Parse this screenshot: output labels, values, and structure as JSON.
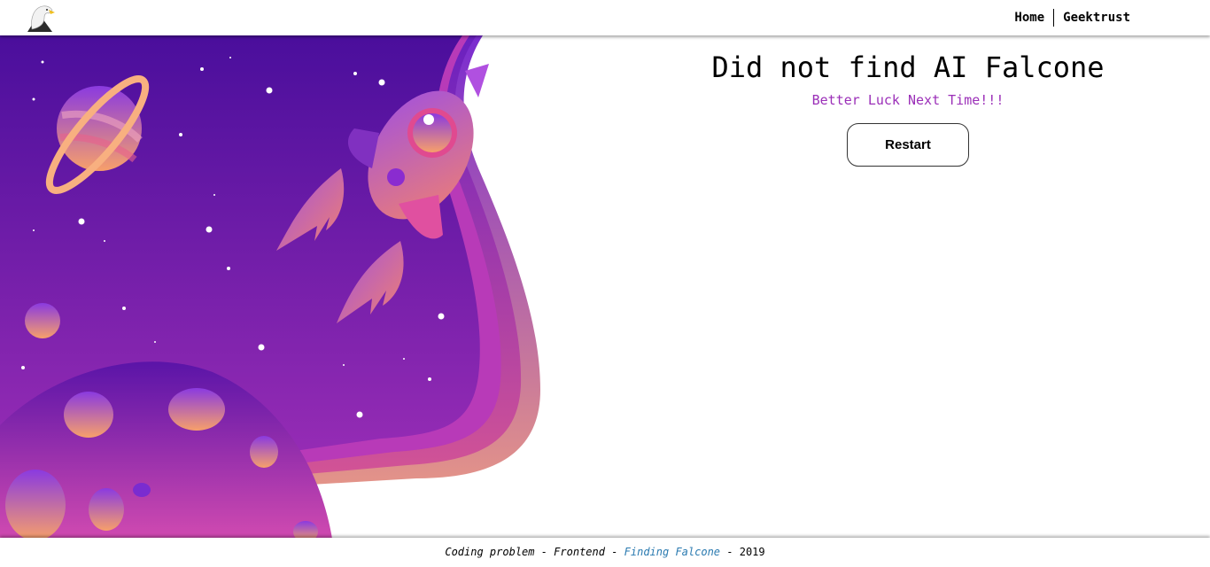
{
  "header": {
    "logo_icon": "eagle-icon",
    "nav": [
      {
        "label": "Home"
      },
      {
        "label": "Geektrust"
      }
    ]
  },
  "hero": {
    "illustration": "space-illustration",
    "colors": {
      "bg_top": "#4a0e9c",
      "bg_bottom": "#a030b8",
      "accent_orange": "#f7a06a",
      "accent_pink": "#e0409c"
    }
  },
  "result": {
    "title": "Did not find AI Falcone",
    "subtitle": "Better Luck Next Time!!!",
    "subtitle_color": "#9b2fb8",
    "restart_label": "Restart"
  },
  "footer": {
    "prefix": "Coding problem - Frontend - ",
    "link": "Finding Falcone",
    "sep": " - ",
    "year": "2019",
    "link_color": "#2a7ab0"
  }
}
